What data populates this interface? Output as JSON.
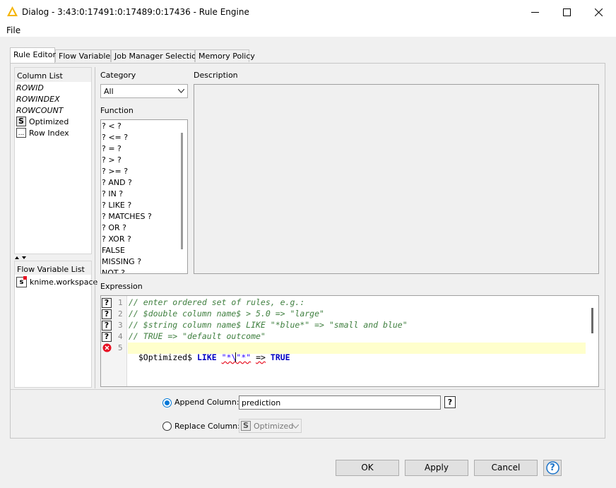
{
  "window": {
    "title": "Dialog - 3:43:0:17491:0:17489:0:17436 - Rule Engine"
  },
  "menu": {
    "file_label": "File"
  },
  "tabs": [
    {
      "label": "Rule Editor"
    },
    {
      "label": "Flow Variables"
    },
    {
      "label": "Job Manager Selection"
    },
    {
      "label": "Memory Policy"
    }
  ],
  "column_list": {
    "header": "Column List",
    "items": [
      "ROWID",
      "ROWINDEX",
      "ROWCOUNT"
    ],
    "columns": [
      {
        "badge": "S",
        "label": "Optimized"
      },
      {
        "badge": "...",
        "label": "Row Index"
      }
    ]
  },
  "flow_variable_list": {
    "header": "Flow Variable List",
    "items": [
      {
        "badge": "s",
        "label": "knime.workspace"
      }
    ]
  },
  "category": {
    "label": "Category",
    "value": "All"
  },
  "function": {
    "label": "Function",
    "items": [
      "? < ?",
      "? <= ?",
      "? = ?",
      "? > ?",
      "? >= ?",
      "? AND ?",
      "? IN ?",
      "? LIKE ?",
      "? MATCHES ?",
      "? OR ?",
      "? XOR ?",
      "FALSE",
      "MISSING ?",
      "NOT ?"
    ]
  },
  "description": {
    "label": "Description"
  },
  "expression": {
    "label": "Expression",
    "line_numbers": [
      "1",
      "2",
      "3",
      "4",
      "5"
    ],
    "lines": [
      "// enter ordered set of rules, e.g.:",
      "// $double column name$ > 5.0 => \"large\"",
      "// $string column name$ LIKE \"*blue*\" => \"small and blue\"",
      "// TRUE => \"default outcome\""
    ],
    "line5": {
      "col": "$Optimized$",
      "op": "LIKE",
      "str1": "\"*\\",
      "str2": "\"*\"",
      "arrow": "=>",
      "val": "TRUE"
    },
    "help_glyph": "?"
  },
  "output": {
    "append_label": "Append Column:",
    "append_value": "prediction",
    "replace_label": "Replace Column:",
    "replace_value": "Optimized",
    "replace_badge": "S",
    "help_glyph": "?"
  },
  "buttons": {
    "ok": "OK",
    "apply": "Apply",
    "cancel": "Cancel",
    "help": "?"
  },
  "colors": {
    "accent": "#0078d7",
    "comment": "#3f7f3f",
    "keyword": "#0000c0",
    "string": "#2a00ff",
    "highlight": "#ffffcc",
    "error": "#e81123"
  }
}
